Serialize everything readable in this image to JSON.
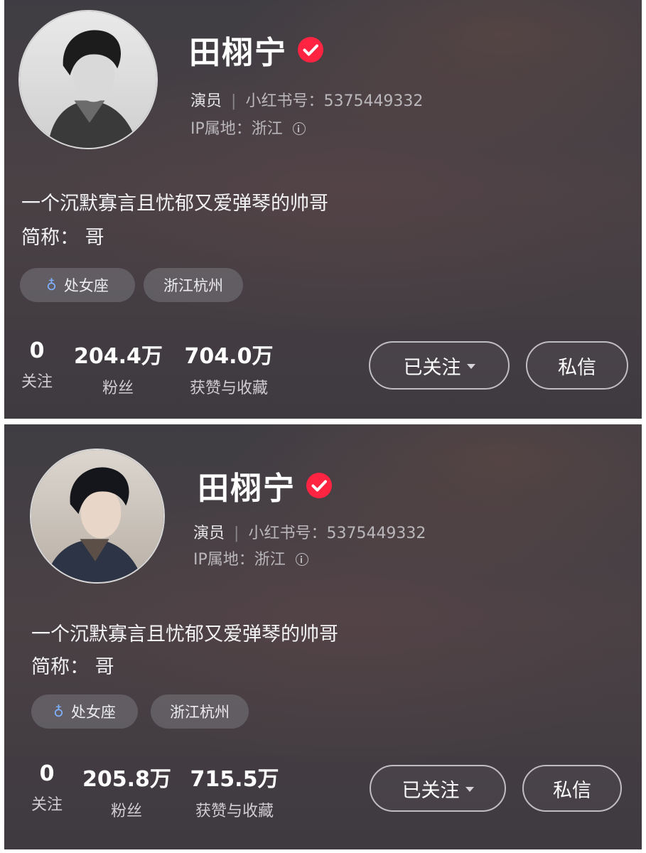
{
  "profiles": [
    {
      "name": "田栩宁",
      "role": "演员",
      "id_label": "小红书号：",
      "id_value": "5375449332",
      "ip_label": "IP属地：",
      "ip_value": "浙江",
      "bio_line1": "一个沉默寡言且忧郁又爱弹琴的帅哥",
      "bio_line2": "简称： 哥",
      "tag_zodiac_symbol": "♁",
      "tag_zodiac": "处女座",
      "tag_location": "浙江杭州",
      "following": "0",
      "following_label": "关注",
      "followers": "204.4万",
      "followers_label": "粉丝",
      "likes": "704.0万",
      "likes_label": "获赞与收藏",
      "follow_button": "已关注",
      "message_button": "私信"
    },
    {
      "name": "田栩宁",
      "role": "演员",
      "id_label": "小红书号：",
      "id_value": "5375449332",
      "ip_label": "IP属地：",
      "ip_value": "浙江",
      "bio_line1": "一个沉默寡言且忧郁又爱弹琴的帅哥",
      "bio_line2": "简称： 哥",
      "tag_zodiac_symbol": "♁",
      "tag_zodiac": "处女座",
      "tag_location": "浙江杭州",
      "following": "0",
      "following_label": "关注",
      "followers": "205.8万",
      "followers_label": "粉丝",
      "likes": "715.5万",
      "likes_label": "获赞与收藏",
      "follow_button": "已关注",
      "message_button": "私信"
    }
  ],
  "colors": {
    "verified_badge": "#ff2442",
    "background": "#433f44",
    "gender_icon": "#7fb0ff"
  },
  "icons": {
    "verified": "verified-check-icon",
    "info": "info-icon",
    "gender": "gender-icon",
    "dropdown": "caret-down-icon"
  }
}
